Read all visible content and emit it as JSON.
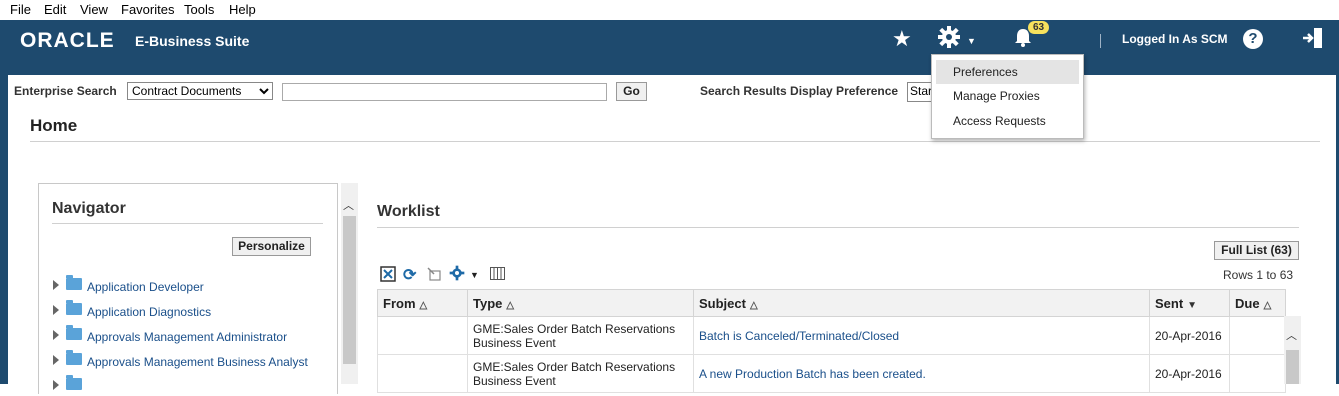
{
  "menubar": [
    "File",
    "Edit",
    "View",
    "Favorites",
    "Tools",
    "Help"
  ],
  "header": {
    "brand": "ORACLE",
    "suite": "E-Business Suite",
    "notifications_count": "63",
    "logged_in": "Logged In As SCM",
    "help_glyph": "?",
    "colors": {
      "header_bg": "#1e4a6e",
      "badge": "#f7e25d",
      "link": "#1a4f8a"
    }
  },
  "dropdown": {
    "items": [
      "Preferences",
      "Manage Proxies",
      "Access Requests"
    ],
    "highlighted": "Preferences"
  },
  "search": {
    "label": "Enterprise Search",
    "category": "Contract Documents",
    "go": "Go",
    "pref_label": "Search Results Display Preference",
    "pref_value": "Star"
  },
  "page": {
    "title": "Home"
  },
  "navigator": {
    "title": "Navigator",
    "personalize": "Personalize",
    "items": [
      "Application Developer",
      "Application Diagnostics",
      "Approvals Management Administrator",
      "Approvals Management Business Analyst"
    ]
  },
  "worklist": {
    "title": "Worklist",
    "full_list": "Full List (63)",
    "rows_label": "Rows 1 to 63",
    "columns": [
      "From",
      "Type",
      "Subject",
      "Sent",
      "Due"
    ],
    "rows": [
      {
        "from": "",
        "type": "GME:Sales Order Batch Reservations Business Event",
        "subject": "Batch is Canceled/Terminated/Closed",
        "sent": "20-Apr-2016",
        "due": ""
      },
      {
        "from": "",
        "type": "GME:Sales Order Batch Reservations Business Event",
        "subject": "A new Production Batch has been created.",
        "sent": "20-Apr-2016",
        "due": ""
      }
    ]
  }
}
